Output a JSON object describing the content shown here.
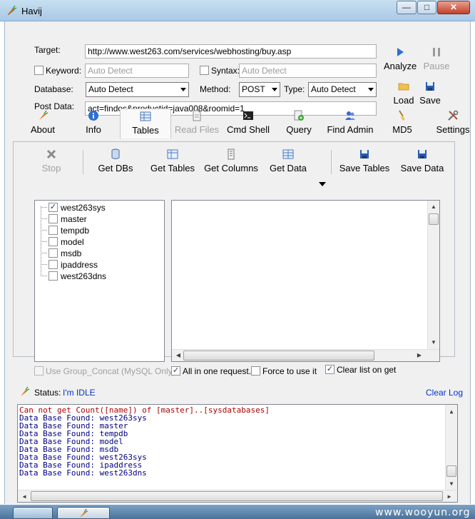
{
  "window": {
    "title": "Havij"
  },
  "form": {
    "target_label": "Target:",
    "target_value": "http://www.west263.com/services/webhosting/buy.asp",
    "keyword_label": "Keyword:",
    "keyword_placeholder": "Auto Detect",
    "syntax_label": "Syntax:",
    "syntax_placeholder": "Auto Detect",
    "database_label": "Database:",
    "database_value": "Auto Detect",
    "method_label": "Method:",
    "method_value": "POST",
    "type_label": "Type:",
    "type_value": "Auto Detect",
    "postdata_label": "Post Data:",
    "postdata_value": "act=findos&productid=java008&roomid=1"
  },
  "actions": {
    "analyze": "Analyze",
    "pause": "Pause",
    "load": "Load",
    "save": "Save"
  },
  "tabs": [
    {
      "label": "About",
      "icon": "carrot-icon"
    },
    {
      "label": "Info",
      "icon": "info-icon"
    },
    {
      "label": "Tables",
      "icon": "table-icon"
    },
    {
      "label": "Read Files",
      "icon": "file-icon"
    },
    {
      "label": "Cmd Shell",
      "icon": "terminal-icon"
    },
    {
      "label": "Query",
      "icon": "query-icon"
    },
    {
      "label": "Find Admin",
      "icon": "users-icon"
    },
    {
      "label": "MD5",
      "icon": "brush-icon"
    },
    {
      "label": "Settings",
      "icon": "tools-icon"
    }
  ],
  "toolbar": {
    "stop": "Stop",
    "get_dbs": "Get DBs",
    "get_tables": "Get Tables",
    "get_columns": "Get Columns",
    "get_data": "Get Data",
    "save_tables": "Save Tables",
    "save_data": "Save Data"
  },
  "tree": [
    {
      "label": "west263sys",
      "checked": true
    },
    {
      "label": "master",
      "checked": false
    },
    {
      "label": "tempdb",
      "checked": false
    },
    {
      "label": "model",
      "checked": false
    },
    {
      "label": "msdb",
      "checked": false
    },
    {
      "label": "ipaddress",
      "checked": false
    },
    {
      "label": "west263dns",
      "checked": false
    }
  ],
  "options": {
    "group_concat": "Use Group_Concat (MySQL Only)",
    "all_in_one": "All in one request.",
    "force_use": "Force to use it",
    "clear_list": "Clear list on get"
  },
  "status": {
    "label": "Status:",
    "value": "I'm IDLE",
    "clear_log": "Clear Log"
  },
  "log": [
    {
      "text": "Can not get Count([name]) of [master]..[sysdatabases]",
      "type": "error"
    },
    {
      "text": "Data Base Found: west263sys",
      "type": "info"
    },
    {
      "text": "Data Base Found: master",
      "type": "info"
    },
    {
      "text": "Data Base Found: tempdb",
      "type": "info"
    },
    {
      "text": "Data Base Found: model",
      "type": "info"
    },
    {
      "text": "Data Base Found: msdb",
      "type": "info"
    },
    {
      "text": "Data Base Found: west263sys",
      "type": "info"
    },
    {
      "text": "Data Base Found: ipaddress",
      "type": "info"
    },
    {
      "text": "Data Base Found: west263dns",
      "type": "info"
    }
  ],
  "watermark": "www.wooyun.org",
  "colors": {
    "error": "#b00000",
    "info": "#000080",
    "link": "#0033cc"
  }
}
